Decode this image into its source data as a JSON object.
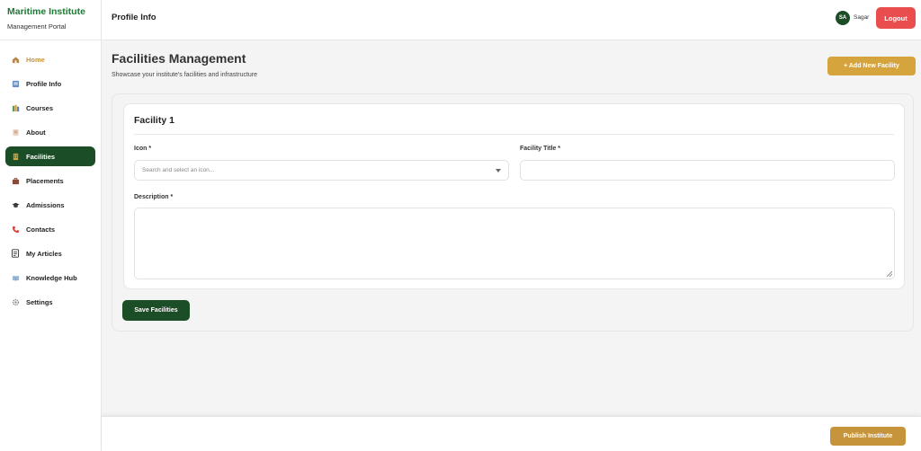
{
  "brand": {
    "title": "Maritime Institute",
    "subtitle": "Management Portal"
  },
  "sidebar": {
    "items": [
      {
        "label": "Home",
        "icon": "home-icon"
      },
      {
        "label": "Profile Info",
        "icon": "profile-icon"
      },
      {
        "label": "Courses",
        "icon": "courses-icon"
      },
      {
        "label": "About",
        "icon": "about-icon"
      },
      {
        "label": "Facilities",
        "icon": "facilities-icon",
        "active": true
      },
      {
        "label": "Placements",
        "icon": "briefcase-icon"
      },
      {
        "label": "Admissions",
        "icon": "graduation-cap-icon"
      },
      {
        "label": "Contacts",
        "icon": "phone-icon"
      },
      {
        "label": "My Articles",
        "icon": "document-icon"
      },
      {
        "label": "Knowledge Hub",
        "icon": "book-icon"
      },
      {
        "label": "Settings",
        "icon": "gear-icon"
      }
    ]
  },
  "header": {
    "title": "Profile Info",
    "user_initials": "SA",
    "user_name": "Sagar",
    "logout_label": "Logout"
  },
  "main": {
    "title": "Facilities Management",
    "subtitle": "Showcase your institute's facilities and infrastructure",
    "add_button_label": "+ Add New Facility",
    "facility": {
      "heading": "Facility 1",
      "icon_label": "Icon *",
      "icon_placeholder": "Search and select an icon...",
      "title_label": "Facility Title *",
      "title_value": "",
      "description_label": "Description *",
      "description_value": ""
    },
    "save_button_label": "Save Facilities"
  },
  "footer": {
    "publish_label": "Publish Institute"
  },
  "colors": {
    "brand_green": "#1f7a35",
    "active_green": "#1b4d26",
    "gold": "#d6a43c",
    "logout_red": "#ea4d4d"
  }
}
